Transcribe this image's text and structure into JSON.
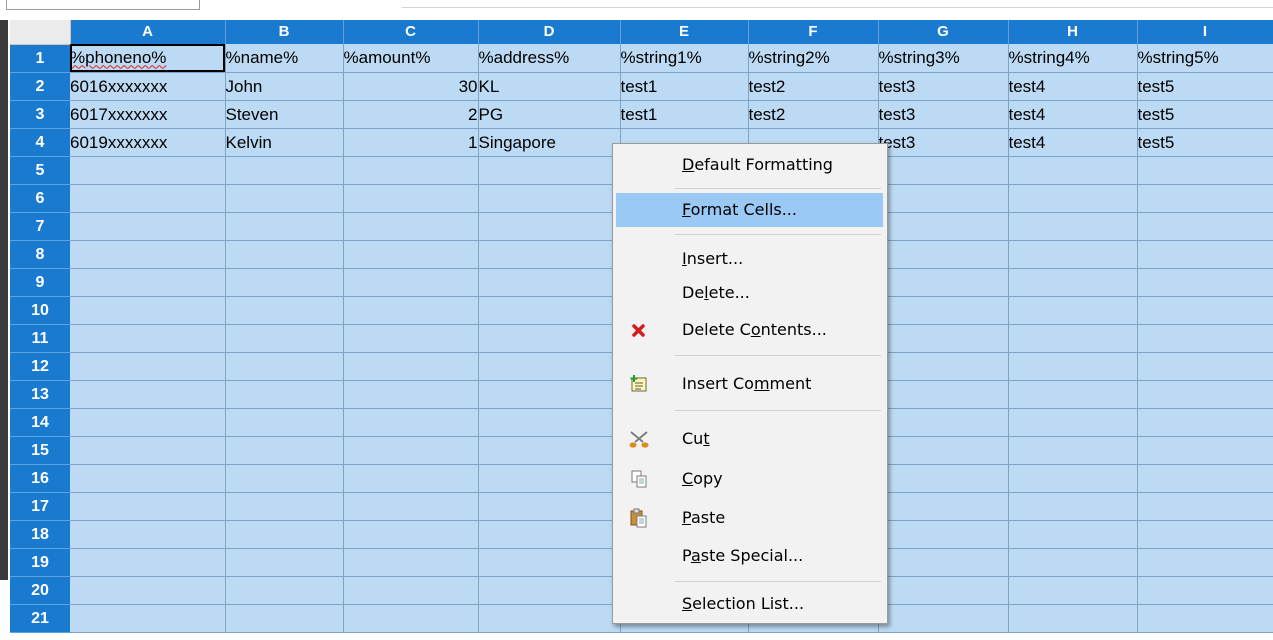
{
  "sheet": {
    "columns": [
      "A",
      "B",
      "C",
      "D",
      "E",
      "F",
      "G",
      "H",
      "I"
    ],
    "row_headers": [
      "1",
      "2",
      "3",
      "4",
      "5",
      "6",
      "7",
      "8",
      "9",
      "10",
      "11",
      "12",
      "13",
      "14",
      "15",
      "16",
      "17",
      "18",
      "19",
      "20",
      "21"
    ],
    "rows": [
      [
        "%phoneno%",
        "%name%",
        "%amount%",
        "%address%",
        "%string1%",
        "%string2%",
        "%string3%",
        "%string4%",
        "%string5%"
      ],
      [
        "6016xxxxxxx",
        "John",
        "30",
        "KL",
        "test1",
        "test2",
        "test3",
        "test4",
        "test5"
      ],
      [
        "6017xxxxxxx",
        "Steven",
        "2",
        "PG",
        "test1",
        "test2",
        "test3",
        "test4",
        "test5"
      ],
      [
        "6019xxxxxxx",
        "Kelvin",
        "1",
        "Singapore",
        "",
        "",
        "test3",
        "test4",
        "test5"
      ]
    ]
  },
  "context_menu": {
    "items": [
      {
        "label": "Default Formatting",
        "hotkey_index": 0,
        "icon": ""
      },
      {
        "label": "Format Cells...",
        "hotkey_index": 0,
        "icon": "",
        "highlighted": true
      },
      {
        "label": "Insert...",
        "hotkey_index": 0,
        "icon": ""
      },
      {
        "label": "Delete...",
        "hotkey_index": 2,
        "icon": ""
      },
      {
        "label": "Delete Contents...",
        "hotkey_index": 8,
        "icon": "delete-contents-icon"
      },
      {
        "label": "Insert Comment",
        "hotkey_index": 9,
        "icon": "insert-comment-icon"
      },
      {
        "label": "Cut",
        "hotkey_index": 2,
        "icon": "scissors-icon"
      },
      {
        "label": "Copy",
        "hotkey_index": 0,
        "icon": "copy-icon"
      },
      {
        "label": "Paste",
        "hotkey_index": 0,
        "icon": "paste-icon"
      },
      {
        "label": "Paste Special...",
        "hotkey_index": 1,
        "icon": ""
      },
      {
        "label": "Selection List...",
        "hotkey_index": 0,
        "icon": ""
      }
    ]
  },
  "colors": {
    "header_blue": "#1a7ad0",
    "selection_fill": "#bcdaf3",
    "menu_highlight": "#99c9f4"
  }
}
